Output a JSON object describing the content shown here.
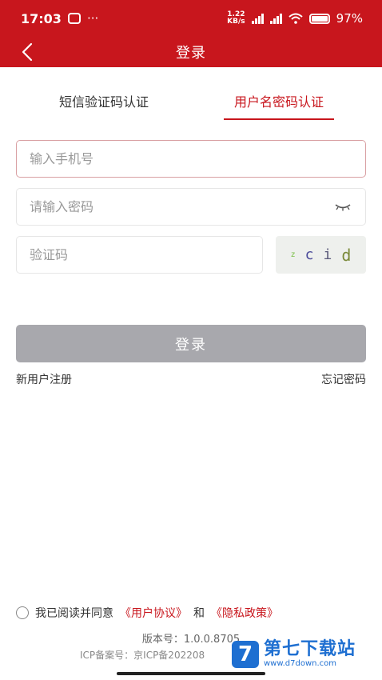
{
  "status_bar": {
    "time": "17:03",
    "dots": "···",
    "speed_top": "1.22",
    "speed_bottom": "KB/s",
    "battery": "97%"
  },
  "nav": {
    "title": "登录"
  },
  "tabs": [
    {
      "label": "短信验证码认证",
      "active": false
    },
    {
      "label": "用户名密码认证",
      "active": true
    }
  ],
  "form": {
    "phone_placeholder": "输入手机号",
    "password_placeholder": "请输入密码",
    "code_placeholder": "验证码",
    "captcha_chars": [
      "z",
      "c",
      "i",
      "d"
    ]
  },
  "login_button": "登录",
  "links": {
    "register": "新用户注册",
    "forgot": "忘记密码"
  },
  "agreement": {
    "prefix": "我已阅读并同意",
    "user_agreement": "《用户协议》",
    "and": "和",
    "privacy_policy": "《隐私政策》"
  },
  "version_text": "版本号：1.0.0.8705",
  "icp_text": "ICP备案号：京ICP备202208",
  "watermark": {
    "title": "第七下载站",
    "url": "www.d7down.com",
    "logo": "7"
  },
  "colors": {
    "brand_red": "#c8161d",
    "button_gray": "#a8a8ad",
    "watermark_blue": "#1e6fd1"
  }
}
